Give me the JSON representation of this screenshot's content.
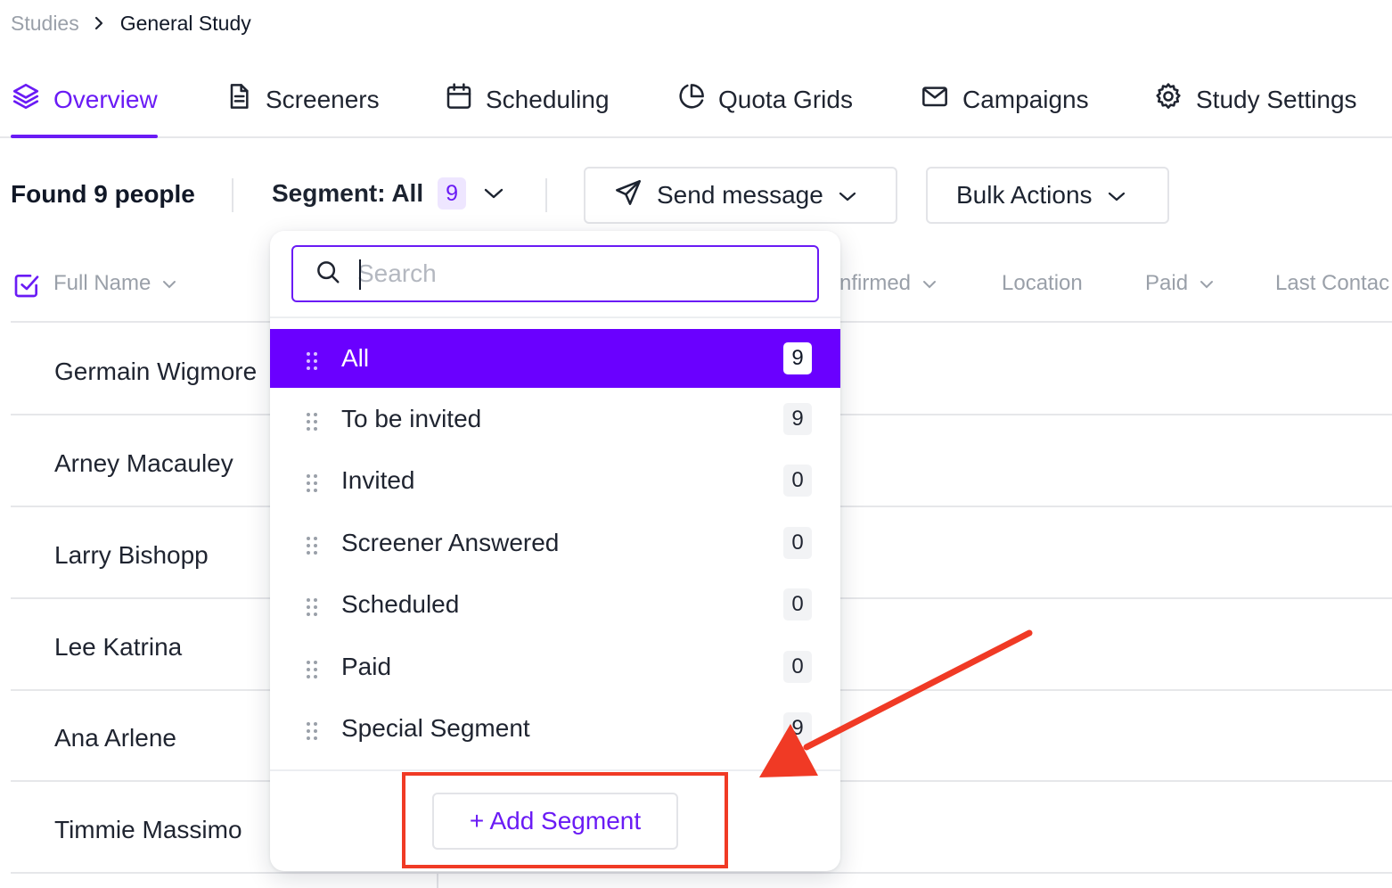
{
  "breadcrumb": {
    "root": "Studies",
    "current": "General Study"
  },
  "tabs": [
    {
      "label": "Overview",
      "icon": "layers-icon",
      "active": true
    },
    {
      "label": "Screeners",
      "icon": "document-icon"
    },
    {
      "label": "Scheduling",
      "icon": "calendar-icon"
    },
    {
      "label": "Quota Grids",
      "icon": "pie-chart-icon"
    },
    {
      "label": "Campaigns",
      "icon": "mail-icon"
    },
    {
      "label": "Study Settings",
      "icon": "gear-icon"
    }
  ],
  "toolbar": {
    "found": "Found 9 people",
    "segment_label": "Segment: All",
    "segment_count": "9",
    "send_message": "Send message",
    "bulk_actions": "Bulk Actions"
  },
  "table": {
    "columns": [
      "Full Name",
      "nfirmed",
      "Location",
      "Paid",
      "Last Contac"
    ],
    "rows": [
      "Germain Wigmore",
      "Arney Macauley",
      "Larry Bishopp",
      "Lee Katrina",
      "Ana Arlene",
      "Timmie Massimo"
    ]
  },
  "dropdown": {
    "search_placeholder": "Search",
    "segments": [
      {
        "label": "All",
        "count": "9",
        "active": true
      },
      {
        "label": "To be invited",
        "count": "9"
      },
      {
        "label": "Invited",
        "count": "0"
      },
      {
        "label": "Screener Answered",
        "count": "0"
      },
      {
        "label": "Scheduled",
        "count": "0"
      },
      {
        "label": "Paid",
        "count": "0"
      },
      {
        "label": "Special Segment",
        "count": "9"
      }
    ],
    "add_segment": "+ Add Segment"
  },
  "colors": {
    "accent": "#6a1bf5",
    "active_row": "#6a00ff",
    "annotation": "#f03a25"
  }
}
